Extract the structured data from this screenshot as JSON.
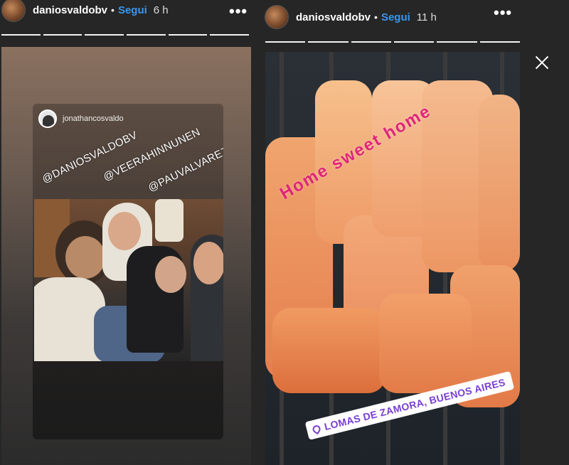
{
  "left_story": {
    "username": "daniosvaldobv",
    "separator": "•",
    "follow_label": "Segui",
    "time": "6 h",
    "more_icon": "more-dots-icon",
    "progress_segments": 6,
    "repost": {
      "username": "jonathancosvaldo",
      "tags": [
        "@DANIOSVALDOBV",
        "@VEERAHINNUNEN",
        "@PAUVALVAREZ"
      ]
    }
  },
  "right_story": {
    "username": "daniosvaldobv",
    "separator": "•",
    "follow_label": "Segui",
    "time": "11 h",
    "more_icon": "more-dots-icon",
    "progress_segments": 6,
    "sticker_text": "Home sweet home",
    "location": "LOMAS DE ZAMORA, BUENOS AIRES",
    "location_icon": "map-pin-icon"
  },
  "close_icon": "close-icon",
  "colors": {
    "follow": "#3897f0",
    "sticker_pink": "#e0257a",
    "location_purple": "#7a3fd1",
    "background": "#262626"
  }
}
